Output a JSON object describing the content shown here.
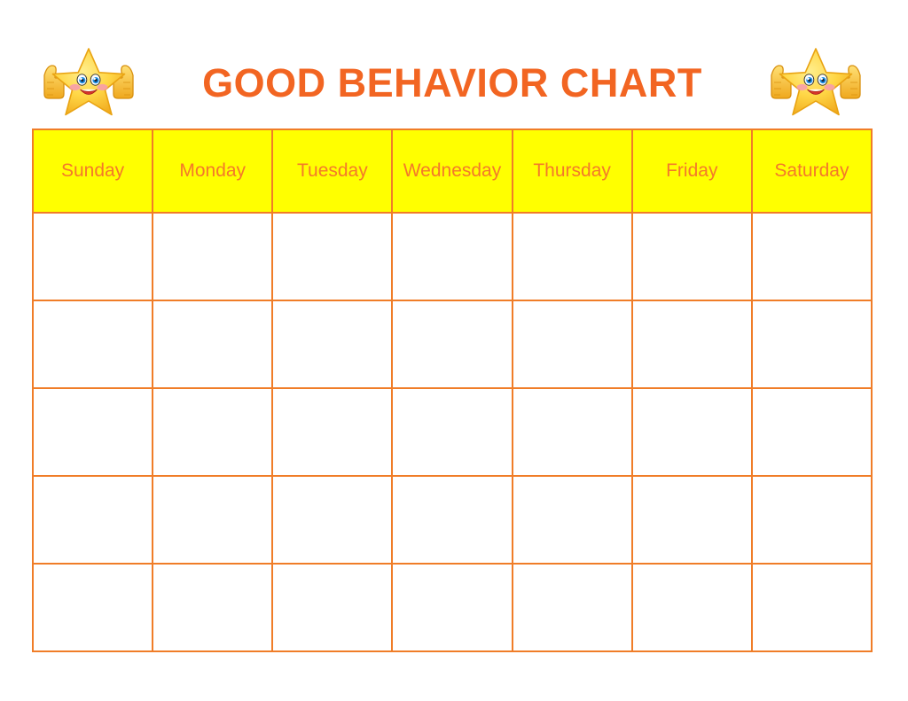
{
  "header": {
    "title": "GOOD BEHAVIOR CHART",
    "left_mascot": "smiling-star-thumbs-up-icon",
    "right_mascot": "smiling-star-thumbs-up-icon"
  },
  "colors": {
    "title_orange": "#F26522",
    "header_cell_yellow": "#FFFF00",
    "header_text_orange": "#F4792A",
    "grid_border_orange": "#F07D28",
    "page_background": "#FFFFFF",
    "star_body": "#FFD23F",
    "star_eye": "#1E90E8",
    "star_mouth": "#E23B2E",
    "star_cheek": "#F79AB0"
  },
  "chart_data": {
    "type": "table",
    "title": "GOOD BEHAVIOR CHART",
    "columns": [
      "Sunday",
      "Monday",
      "Tuesday",
      "Wednesday",
      "Thursday",
      "Friday",
      "Saturday"
    ],
    "rows": [
      [
        "",
        "",
        "",
        "",
        "",
        "",
        ""
      ],
      [
        "",
        "",
        "",
        "",
        "",
        "",
        ""
      ],
      [
        "",
        "",
        "",
        "",
        "",
        "",
        ""
      ],
      [
        "",
        "",
        "",
        "",
        "",
        "",
        ""
      ],
      [
        "",
        "",
        "",
        "",
        "",
        "",
        ""
      ]
    ],
    "row_count": 5,
    "column_count": 7,
    "all_cells_blank": true
  }
}
